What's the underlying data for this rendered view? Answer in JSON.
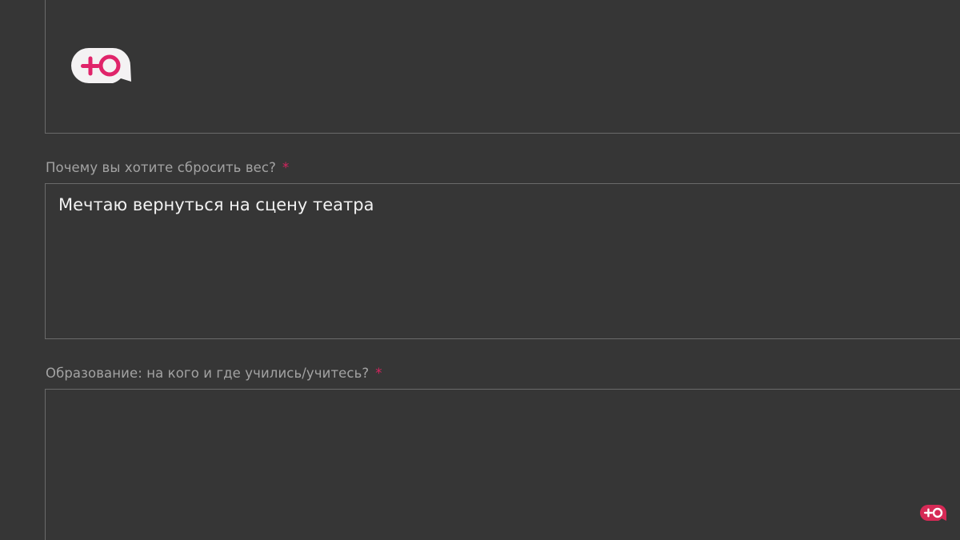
{
  "form": {
    "fields": [
      {
        "label": "Почему вы хотите сбросить вес?",
        "required_mark": "*",
        "value": "Мечтаю вернуться на сцену театра"
      },
      {
        "label": "Образование: на кого и где учились/учитесь?",
        "required_mark": "*",
        "value": ""
      }
    ]
  },
  "branding": {
    "logo_icon": "plus-o-speech-bubble-icon",
    "watermark_icon": "plus-o-watermark-icon",
    "accent_color": "#e0246a",
    "logo_bubble_color": "#f4f2f3",
    "watermark_color": "#d62a56"
  }
}
